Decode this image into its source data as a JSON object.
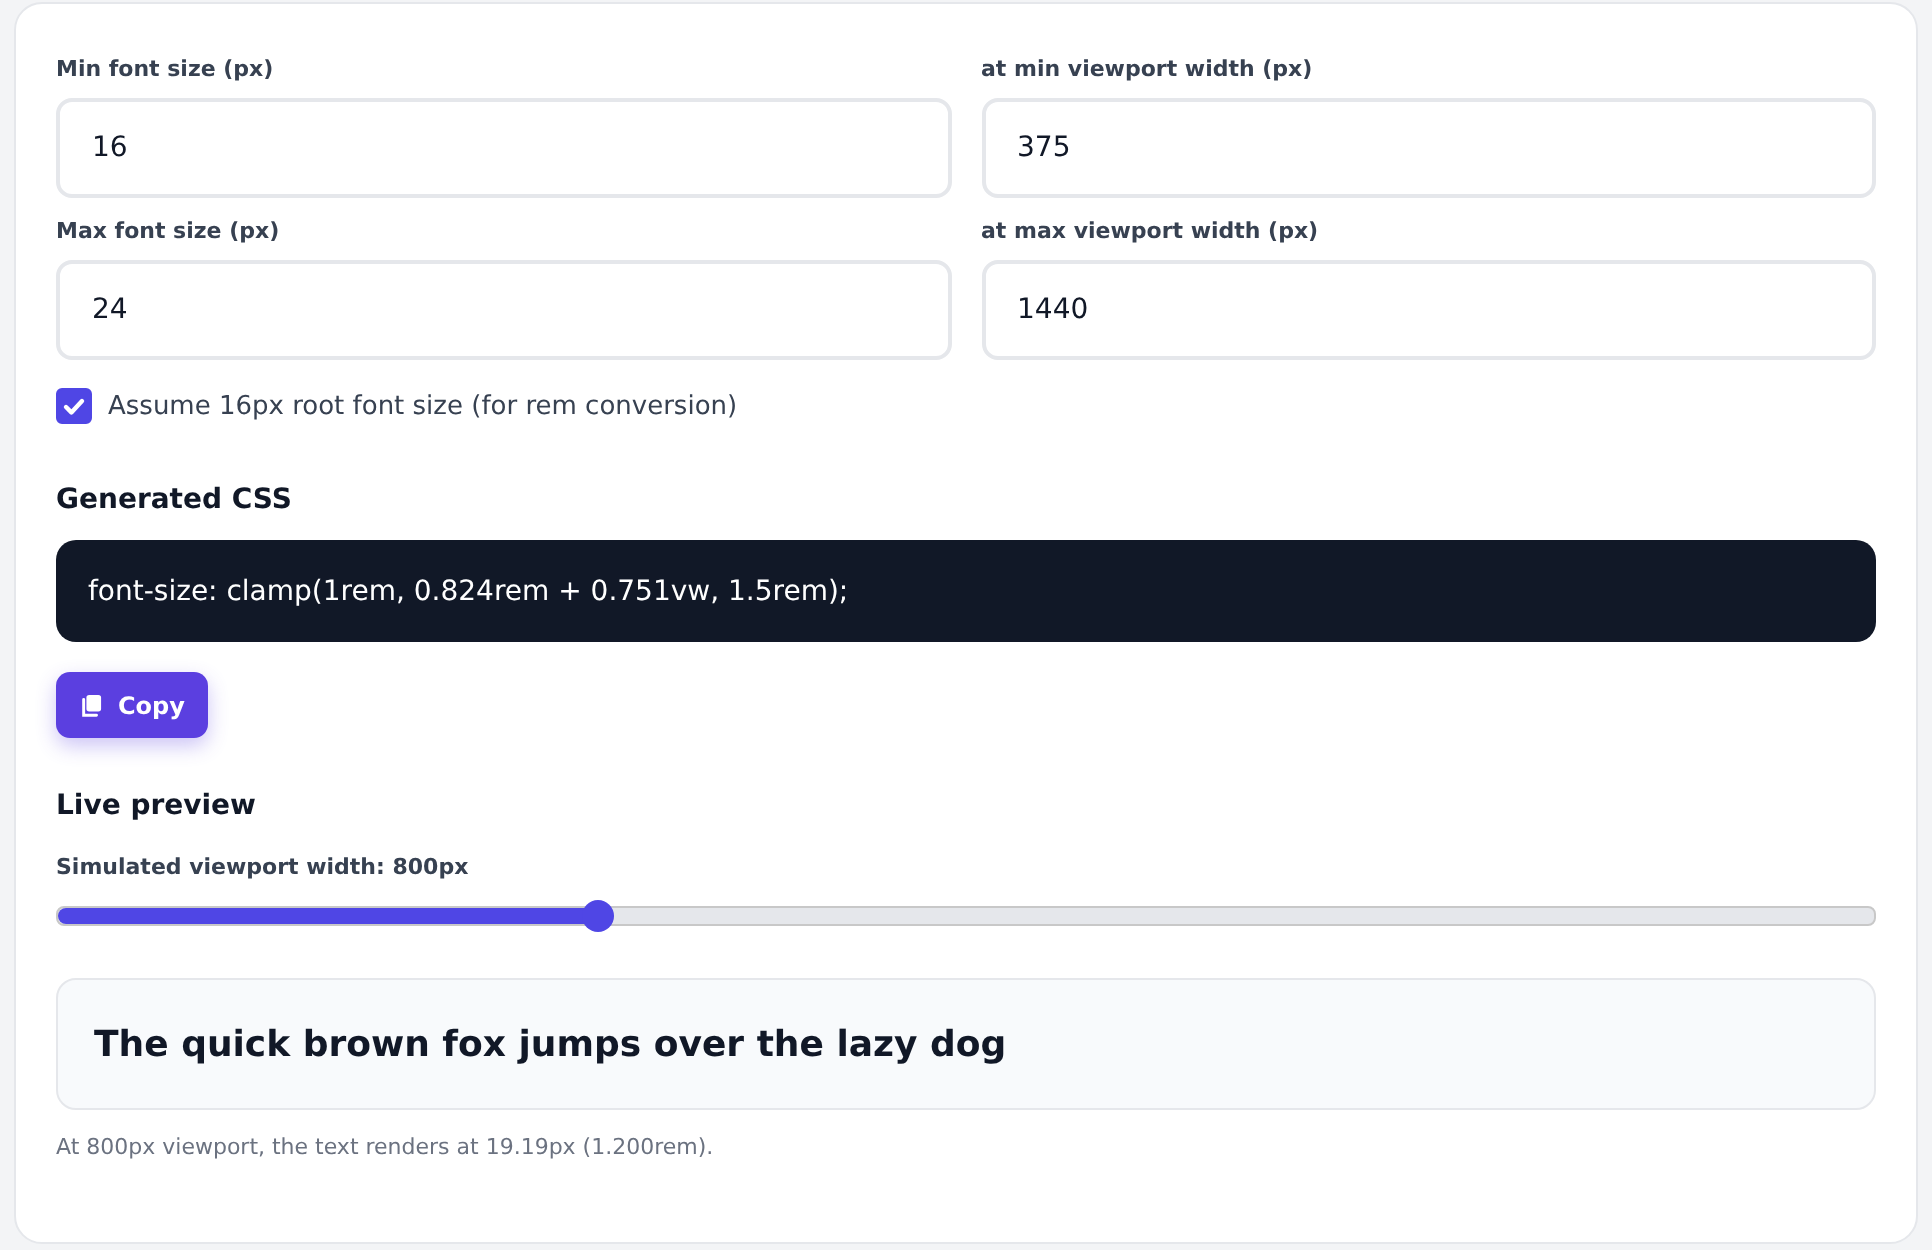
{
  "fields": [
    {
      "label": "Min font size (px)",
      "value": "16"
    },
    {
      "label": "at min viewport width (px)",
      "value": "375"
    },
    {
      "label": "Max font size (px)",
      "value": "24"
    },
    {
      "label": "at max viewport width (px)",
      "value": "1440"
    }
  ],
  "rem_checkbox": {
    "label": "Assume 16px root font size (for rem conversion)",
    "checked": true
  },
  "generated_css": {
    "heading": "Generated CSS",
    "code": "font-size: clamp(1rem, 0.824rem + 0.751vw, 1.5rem);",
    "copy_button": "Copy"
  },
  "live_preview": {
    "heading": "Live preview",
    "slider_label": "Simulated viewport width: 800px",
    "level": 0.297,
    "sample_text": "The quick brown fox jumps over the lazy dog",
    "caption": "At 800px viewport, the text renders at 19.19px (1.200rem)."
  }
}
